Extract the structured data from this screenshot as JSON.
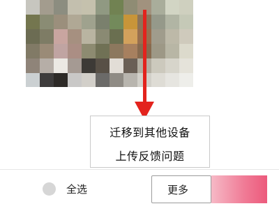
{
  "photo": {
    "tile_colors": [
      [
        "#c7c6bf",
        "#a39c8e",
        "#8c8d80",
        "#c3bfae",
        "#c5c1ad",
        "#909982",
        "#718252",
        "#8f8c74",
        "#a1927e",
        "#a9ad9b",
        "#d2d5c4",
        "#cfd0bf"
      ],
      [
        "#74764f",
        "#8a8c74",
        "#9b8f7c",
        "#b0a895",
        "#9fa28e",
        "#7a806d",
        "#738a5b",
        "#c89539",
        "#8c7459",
        "#95998a",
        "#b1b5a4",
        "#c5c9b7"
      ],
      [
        "#6c6c53",
        "#7e7c65",
        "#c9a5a0",
        "#a69080",
        "#b9b4a1",
        "#8a8a73",
        "#6a6f50",
        "#d3a15c",
        "#986f4f",
        "#a09c8c",
        "#bdb9a8",
        "#cfcabc"
      ],
      [
        "#817a66",
        "#9a8b77",
        "#c0a4a2",
        "#ab8e84",
        "#8d8b71",
        "#707155",
        "#8c785e",
        "#a7805f",
        "#876a4f",
        "#9d9886",
        "#b8b6a5",
        "#dcdacc"
      ],
      [
        "#8f8479",
        "#b6aea7",
        "#ece9e4",
        "#a59a93",
        "#3d3a36",
        "#585046",
        "#e2ddd6",
        "#6a5f55",
        "#b3aea1",
        "#ccc9bd",
        "#d7d5cb",
        "#e5e3da"
      ],
      [
        "#cbd0d2",
        "#3e3c3c",
        "#2d2a27",
        "#c9c8c7",
        "#d2cfc9",
        "#6b6a68",
        "#8f8b84",
        "#b8b5ae",
        "#d2d0c9",
        "#dedcd5",
        "#e6e5e0",
        "#eeeeea"
      ]
    ]
  },
  "menu": {
    "item1": "迁移到其他设备",
    "item2": "上传反馈问题"
  },
  "toolbar": {
    "select_all": "全选",
    "more": "更多"
  }
}
